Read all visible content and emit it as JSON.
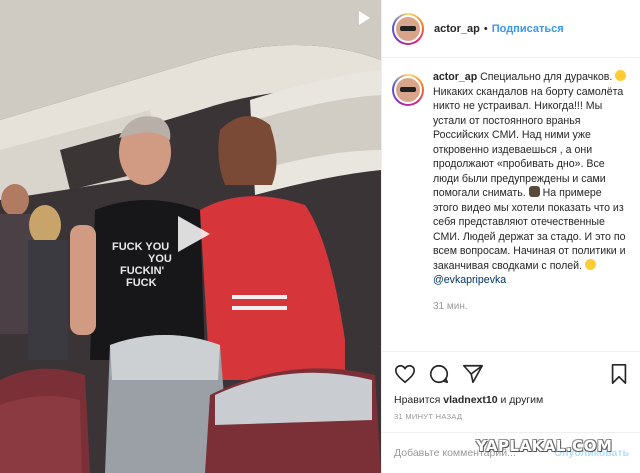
{
  "post": {
    "username": "actor_ap",
    "follow_label": "Подписаться",
    "caption_lines": [
      "Специально для дурачков.",
      "Никаких скандалов на борту",
      "самолёта никто не устраивал.",
      "Никогда!!! Мы устали от",
      "постоянного вранья Российских",
      "СМИ. Над ними уже откровенно",
      "издеваешься , а они продолжают",
      "«пробивать дно». Все люди были",
      "предупреждены и сами помогали",
      "снимать.",
      "На примере этого",
      "видео мы хотели показать что из",
      "себя представляют отечественные",
      "СМИ. Людей держат за стадо. И это",
      "по всем вопросам. Начиная от",
      "политики и заканчивая сводками с",
      "полей."
    ],
    "mention": "@evkapripevka",
    "caption_time": "31 мин.",
    "likes_prefix": "Нравится",
    "likes_user": "vladnext10",
    "likes_suffix": "и другим",
    "timestamp": "31 МИНУТ НАЗАД",
    "comment_placeholder": "Добавьте комментарий...",
    "publish_label": "Опубликовать"
  },
  "video": {
    "shirt_text": [
      "FUCK YOU",
      "YOU",
      "FUCKIN'",
      "FUCK"
    ]
  },
  "watermark": "YAPLAKAL.COM",
  "colors": {
    "link": "#3897f0",
    "muted": "#999999",
    "text": "#262626",
    "border": "#efefef"
  }
}
